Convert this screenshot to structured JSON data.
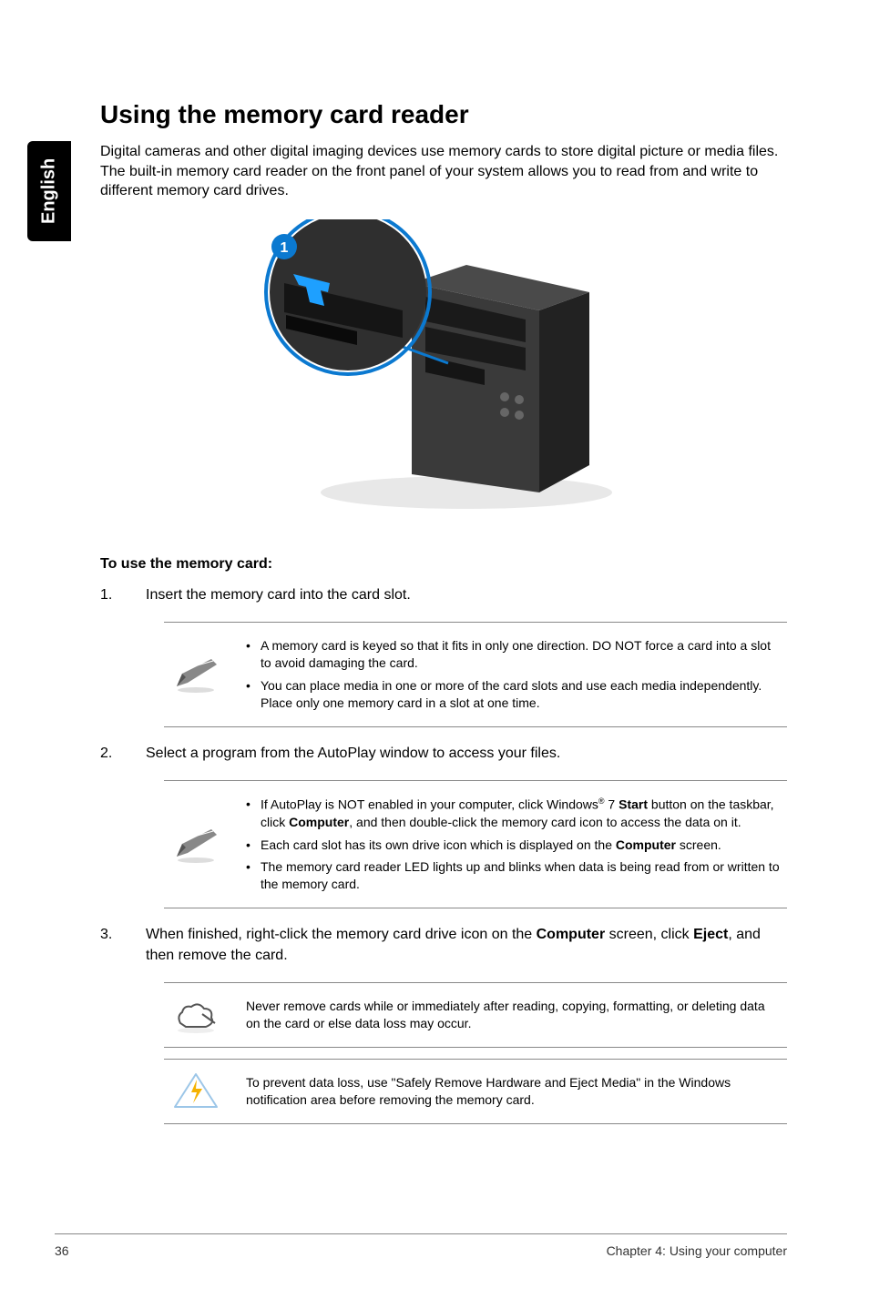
{
  "sideTab": "English",
  "title": "Using the memory card reader",
  "intro": "Digital cameras and other digital imaging devices use memory cards to store digital picture or media files. The built-in memory card reader on the front panel of your system allows you to read from and write to different memory card drives.",
  "figure": {
    "callout": "1"
  },
  "subhead": "To use the memory card:",
  "steps": {
    "s1": "Insert the memory card into the card slot.",
    "s2": "Select a program from the AutoPlay window to access your files.",
    "s3_pre": "When finished, right-click the memory card drive icon on the ",
    "s3_bold1": "Computer",
    "s3_mid": " screen, click ",
    "s3_bold2": "Eject",
    "s3_post": ", and then remove the card."
  },
  "note1": {
    "a": "A memory card is keyed so that it fits in only one direction. DO NOT force a card into a slot to avoid damaging the card.",
    "b": "You can place media in one or more of the card slots and use each media independently. Place only one memory card in a slot at one time."
  },
  "note2": {
    "a_pre": "If AutoPlay is NOT enabled in your computer, click Windows",
    "a_sup": "®",
    "a_mid": " 7 ",
    "a_bold1": "Start",
    "a_mid2": " button on the taskbar, click ",
    "a_bold2": "Computer",
    "a_post": ", and then double-click the memory card icon to access the data on it.",
    "b_pre": "Each card slot has its own drive icon which is displayed on the ",
    "b_bold": "Computer",
    "b_post": " screen.",
    "c": "The memory card reader LED lights up and blinks when data is being read from or written to the memory card."
  },
  "note3": "Never remove cards while or immediately after reading, copying, formatting, or deleting data on the card or else data loss may occur.",
  "note4": "To prevent data loss, use \"Safely Remove Hardware and Eject Media\" in the Windows notification area before removing the memory card.",
  "footer": {
    "page": "36",
    "chapter": "Chapter 4: Using your computer"
  }
}
